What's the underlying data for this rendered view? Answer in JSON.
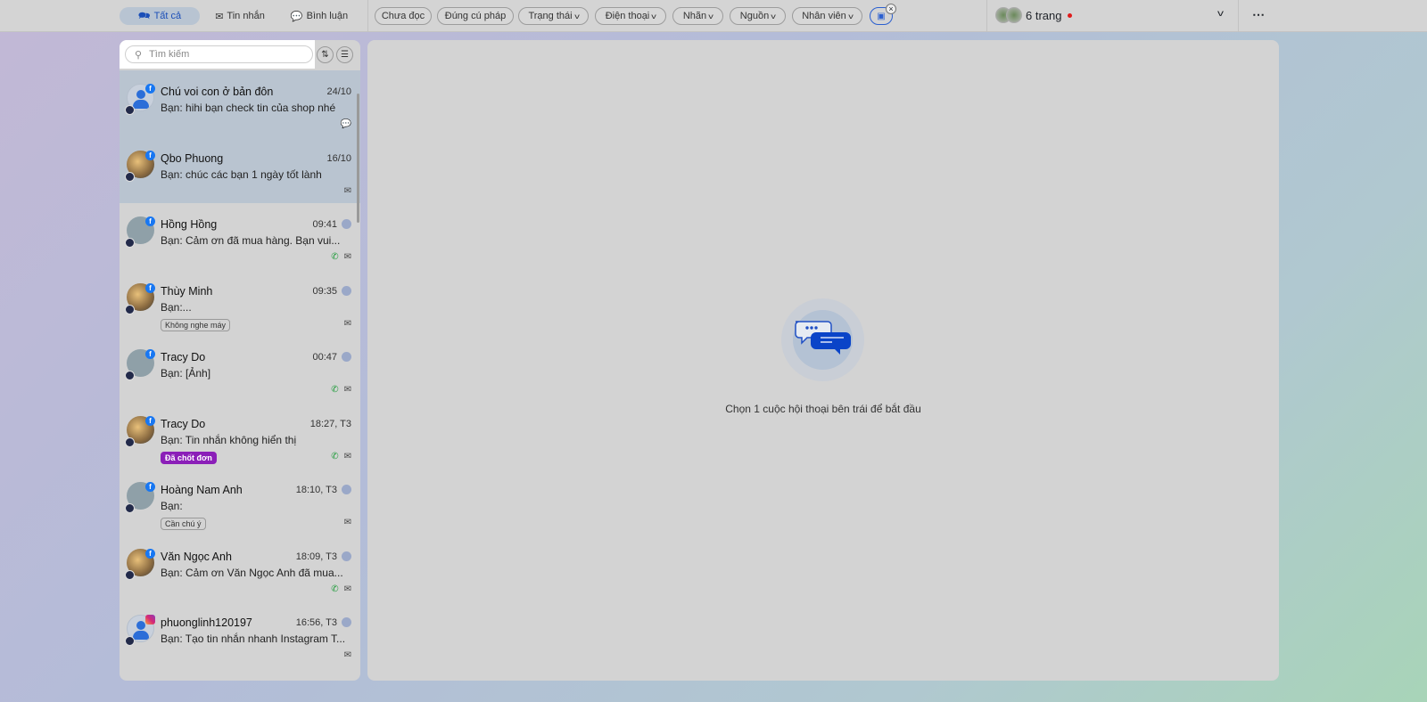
{
  "topbar": {
    "tabs": [
      {
        "label": "Tất cả",
        "icon": "chat-icon",
        "active": true
      },
      {
        "label": "Tin nhắn",
        "icon": "mail-icon"
      },
      {
        "label": "Bình luận",
        "icon": "comment-icon"
      }
    ],
    "filters": [
      {
        "label": "Chưa đọc",
        "dropdown": false
      },
      {
        "label": "Đúng cú pháp",
        "dropdown": false
      },
      {
        "label": "Trạng thái",
        "dropdown": true
      },
      {
        "label": "Điện thoại",
        "dropdown": true
      },
      {
        "label": "Nhãn",
        "dropdown": true
      },
      {
        "label": "Nguồn",
        "dropdown": true
      },
      {
        "label": "Nhân viên",
        "dropdown": true
      }
    ],
    "pages_label": "6 trang",
    "more_icon": "⋯"
  },
  "sidebar": {
    "search_placeholder": "Tìm kiếm",
    "conversations": [
      {
        "name": "Chú voi con ở bản đôn",
        "time": "24/10",
        "message": "Bạn: hihi bạn check tin của shop nhé",
        "source": "facebook",
        "selected": true,
        "icons": [
          "comment"
        ]
      },
      {
        "name": "Qbo Phuong",
        "time": "16/10",
        "message": "Bạn: chúc các bạn 1 ngày tốt lành",
        "source": "facebook",
        "selected": true,
        "icons": [
          "mail"
        ]
      },
      {
        "name": "Hồng Hồng",
        "time": "09:41",
        "message": "Bạn: Cảm ơn đã mua hàng. Bạn vui...",
        "source": "facebook",
        "icons": [
          "phone",
          "mail"
        ],
        "assignee": true
      },
      {
        "name": "Thùy Minh",
        "time": "09:35",
        "message": "Bạn:...",
        "source": "facebook",
        "tag": "Không nghe máy",
        "icons": [
          "mail"
        ],
        "assignee": true
      },
      {
        "name": "Tracy Do",
        "time": "00:47",
        "message": "Bạn: [Ảnh]",
        "source": "facebook",
        "icons": [
          "phone",
          "mail"
        ],
        "assignee": true
      },
      {
        "name": "Tracy Do",
        "time": "18:27, T3",
        "message": "Bạn: Tin nhắn không hiển thị",
        "source": "facebook",
        "tag": "Đã chốt đơn",
        "tag_color": "#8b1fb8",
        "icons": [
          "phone",
          "mail"
        ]
      },
      {
        "name": "Hoàng Nam Anh",
        "time": "18:10, T3",
        "message": "Bạn:",
        "source": "facebook",
        "tag": "Cần chú ý",
        "icons": [
          "mail"
        ],
        "assignee": true
      },
      {
        "name": "Văn Ngọc Anh",
        "time": "18:09, T3",
        "message": "Bạn: Cảm ơn Văn Ngọc Anh đã mua...",
        "source": "facebook",
        "icons": [
          "phone",
          "mail"
        ],
        "assignee": true
      },
      {
        "name": "phuonglinh120197",
        "time": "16:56, T3",
        "message": "Bạn: Tạo tin nhắn nhanh Instagram T...",
        "source": "instagram",
        "icons": [
          "mail"
        ],
        "assignee": true
      }
    ]
  },
  "main": {
    "empty_text": "Chọn 1 cuộc hội thoại bên trái để bắt đầu"
  }
}
